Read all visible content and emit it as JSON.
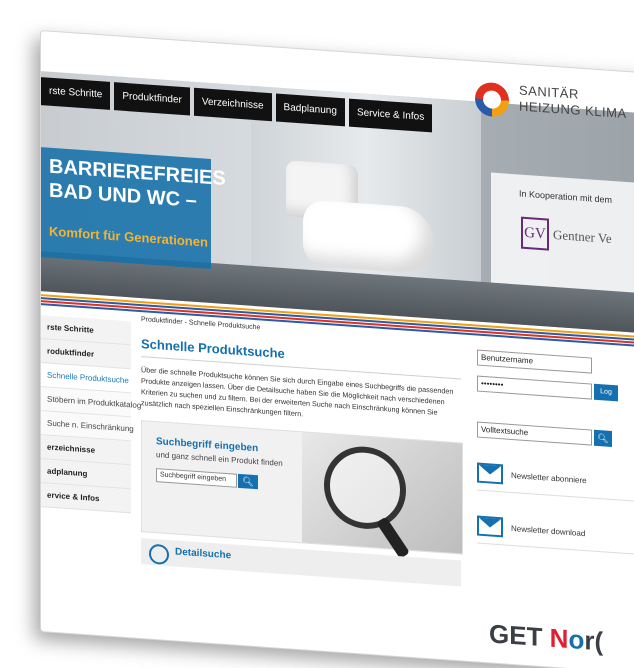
{
  "nav": {
    "tabs": [
      "rste Schritte",
      "Produktfinder",
      "Verzeichnisse",
      "Badplanung",
      "Service & Infos"
    ]
  },
  "logo": {
    "line1": "SANITÄR",
    "line2": "HEIZUNG KLIMA"
  },
  "cooperation": {
    "text": "In Kooperation mit dem",
    "logo_letters": "GV",
    "logo_name": "Gentner Ve"
  },
  "banner": {
    "line1": "BARRIEREFREIES",
    "line2": "BAD UND WC –",
    "subline": "Komfort für Generationen"
  },
  "sidebar": {
    "items": [
      "rste Schritte",
      "roduktfinder",
      "Schnelle Produktsuche",
      "Stöbern im Produktkatalog",
      "Suche n. Einschränkung",
      "erzeichnisse",
      "adplanung",
      "ervice & Infos"
    ]
  },
  "main": {
    "breadcrumb": "Produktfinder - Schnelle Produktsuche",
    "title": "Schnelle Produktsuche",
    "description": "Über die schnelle Produktsuche können Sie sich durch Eingabe eines Suchbegriffs die passenden Produkte anzeigen lassen. Über die Detailsuche haben Sie die Möglichkeit nach verschiedenen Kriterien zu suchen und zu filtern. Bei der erweiterten Suche nach Einschränkung können Sie zusätzlich nach speziellen Einschränkungen filtern.",
    "search_heading": "Suchbegriff eingeben",
    "search_sub": "und ganz schnell ein Produkt finden",
    "search_value": "Suchbegriff eingeben",
    "detail_label": "Detailsuche"
  },
  "login": {
    "username": "Benutzername",
    "password": "••••••••",
    "button": "Log"
  },
  "fulltext": {
    "value": "Volltextsuche"
  },
  "newsletter": {
    "subscribe": "Newsletter abonniere",
    "download": "Newsletter download"
  },
  "brand": {
    "g": "GET ",
    "n": "N",
    "o": "o",
    "rest": "r("
  },
  "colors": {
    "accent": "#1570b0",
    "banner": "#1470aa",
    "subline": "#f3b433",
    "stripe_orange": "#f0a010",
    "stripe_blue": "#2a5aa8",
    "stripe_red": "#e03020"
  }
}
